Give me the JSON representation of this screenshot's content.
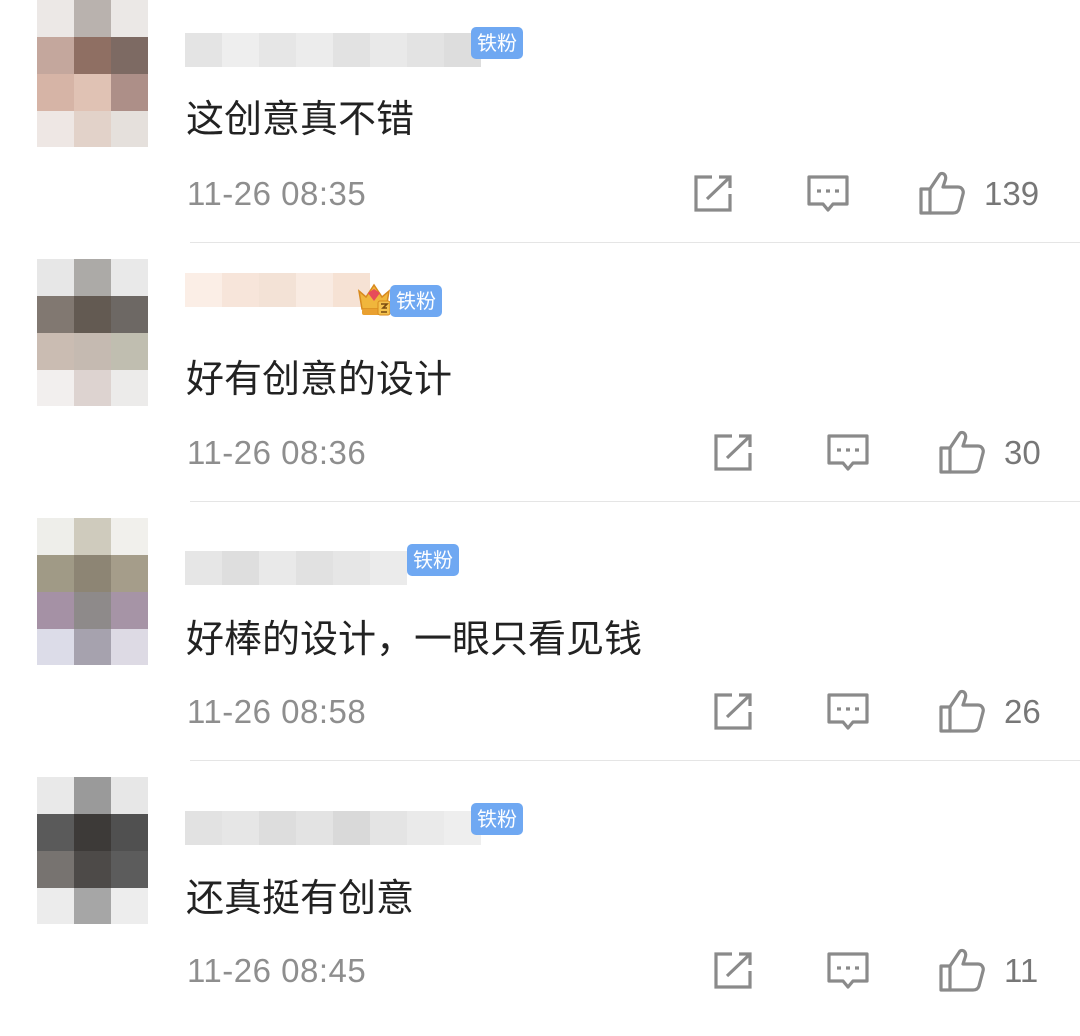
{
  "comments": [
    {
      "text": "这创意真不错",
      "time": "11-26 08:35",
      "badge": "铁粉",
      "likes": "139",
      "has_crown": false
    },
    {
      "text": "好有创意的设计",
      "time": "11-26 08:36",
      "badge": "铁粉",
      "likes": "30",
      "has_crown": true
    },
    {
      "text": "好棒的设计，一眼只看见钱",
      "time": "11-26 08:58",
      "badge": "铁粉",
      "likes": "26",
      "has_crown": false
    },
    {
      "text": "还真挺有创意",
      "time": "11-26 08:45",
      "badge": "铁粉",
      "likes": "11",
      "has_crown": false
    }
  ],
  "icons": {
    "share": "share-icon",
    "reply": "comment-icon",
    "like": "thumbs-up-icon"
  },
  "colors": {
    "badge": "#6fa8f2",
    "text": "#222222",
    "meta": "#8e8e8e"
  }
}
